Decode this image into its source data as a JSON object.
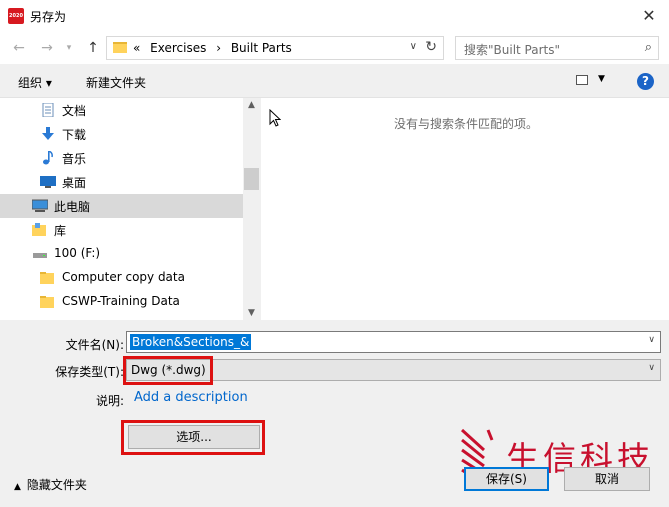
{
  "window": {
    "title": "另存为",
    "app_badge": "2020"
  },
  "nav": {
    "breadcrumb": [
      "«",
      "Exercises",
      "›",
      "Built Parts"
    ],
    "search_placeholder": "搜索\"Built Parts\""
  },
  "toolbar": {
    "organize": "组织 ▾",
    "new_folder": "新建文件夹",
    "help": "?"
  },
  "tree": {
    "items": [
      {
        "label": "文档",
        "icon": "document-icon"
      },
      {
        "label": "下载",
        "icon": "download-icon"
      },
      {
        "label": "音乐",
        "icon": "music-icon"
      },
      {
        "label": "桌面",
        "icon": "desktop-icon"
      },
      {
        "label": "此电脑",
        "icon": "computer-icon",
        "selected": true
      },
      {
        "label": "库",
        "icon": "library-icon"
      },
      {
        "label": "100 (F:)",
        "icon": "drive-icon"
      },
      {
        "label": "Computer copy data",
        "icon": "folder-icon"
      },
      {
        "label": "CSWP-Training Data",
        "icon": "folder-icon"
      }
    ]
  },
  "content": {
    "empty_message": "没有与搜索条件匹配的项。"
  },
  "form": {
    "filename_label": "文件名(N):",
    "filename_value": "Broken&Sections_&",
    "filetype_label": "保存类型(T):",
    "filetype_value": "Dwg (*.dwg)",
    "description_label": "说明:",
    "description_link": "Add a description",
    "options_button": "选项...",
    "hide_folders": "隐藏文件夹",
    "save_button": "保存(S)",
    "cancel_button": "取消"
  },
  "watermark": {
    "text": "生信科技"
  },
  "colors": {
    "accent": "#0078d7",
    "highlight_box": "#dd1111",
    "selected_row": "#d9d9d9",
    "watermark": "#c8102e"
  }
}
